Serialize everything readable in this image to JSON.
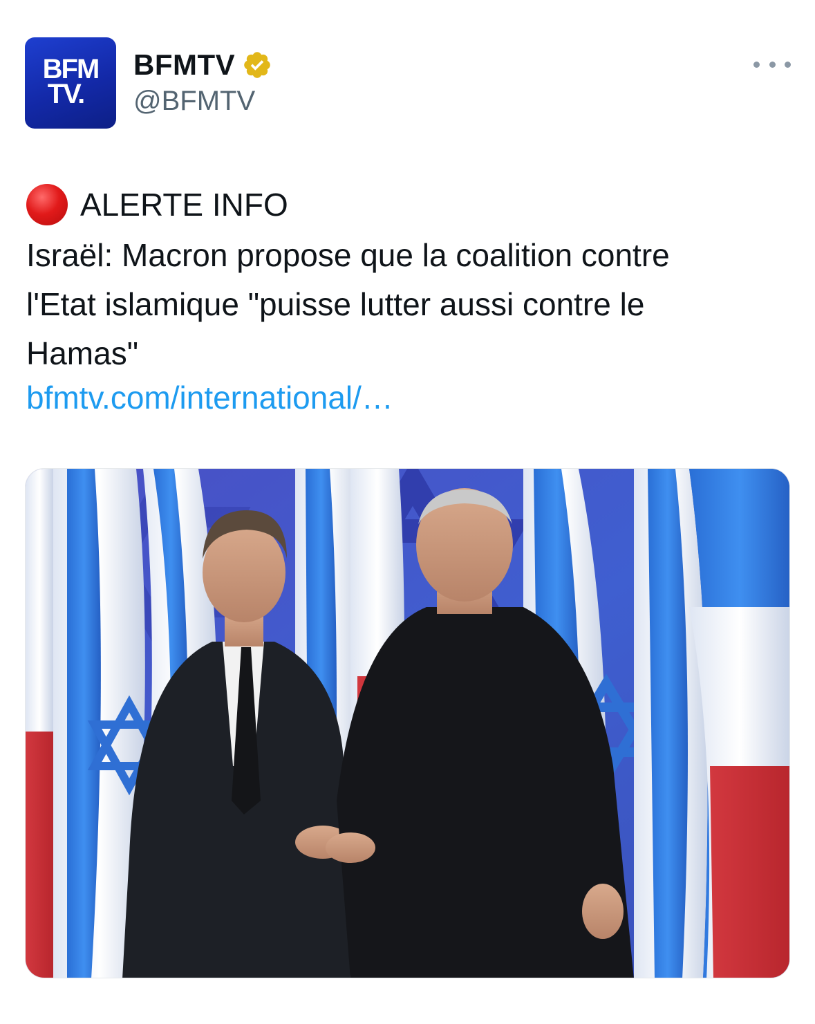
{
  "account": {
    "display_name": "BFMTV",
    "handle": "@BFMTV",
    "verified": true,
    "verified_badge_color": "#e2b719",
    "avatar": {
      "logo_line1": "BFM",
      "logo_line2": "TV.",
      "background_color": "#1a36c0"
    }
  },
  "menu": {
    "icon": "more-horizontal-icon"
  },
  "tweet": {
    "alert_emoji": "red-circle-icon",
    "alert_label": "ALERTE INFO",
    "text_lines": [
      "Israël: Macron propose que la coalition contre",
      "l'Etat islamique \"puisse lutter aussi contre le",
      "Hamas\""
    ],
    "link_text": "bfmtv.com/international/…",
    "link_color": "#1d9bf0"
  },
  "media": {
    "type": "photo"
  }
}
